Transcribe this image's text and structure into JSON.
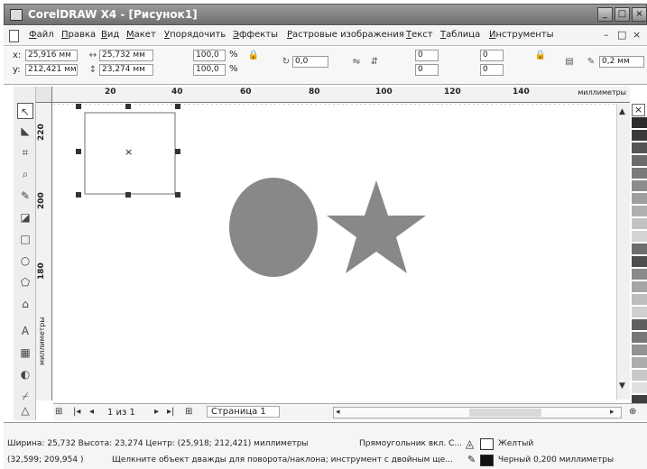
{
  "window": {
    "title": "CorelDRAW X4 - [Рисунок1]",
    "controls": [
      "_",
      "□",
      "×"
    ]
  },
  "menu": {
    "items": [
      "Файл",
      "Правка",
      "Вид",
      "Макет",
      "Упорядочить",
      "Эффекты",
      "Растровые изображения",
      "Текст",
      "Таблица",
      "Инструменты"
    ],
    "doc_controls": [
      "–",
      "□",
      "×"
    ]
  },
  "propbar": {
    "x_label": "x:",
    "x_value": "25,916 мм",
    "y_label": "y:",
    "y_value": "212,421 мм",
    "width_value": "25,732 мм",
    "height_value": "23,274 мм",
    "scale_x": "100,0",
    "scale_y": "100,0",
    "percent": "%",
    "rotation": "0,0",
    "corner_a": "0",
    "corner_b": "0",
    "corner_c": "0",
    "corner_d": "0",
    "outline_width": "0,2 мм"
  },
  "ruler": {
    "h_ticks": [
      "20",
      "40",
      "60",
      "80",
      "100",
      "120",
      "140"
    ],
    "h_unit": "миллиметры",
    "v_ticks": [
      "220",
      "200",
      "180"
    ],
    "v_unit": "миллиметры"
  },
  "canvas": {
    "circle_color": "#888888",
    "star_color": "#888888",
    "selection_marker": "×"
  },
  "pagebar": {
    "page_count": "1 из 1",
    "page_tab": "Страница 1"
  },
  "status": {
    "size_info": "Ширина: 25,732 Высота: 23,274 Центр: (25,918; 212,421) миллиметры",
    "object_info": "Прямоугольник вкл. С...",
    "fill_name": "Желтый",
    "cursor_pos": "(32,599; 209,954 )",
    "hint": "Щелкните объект дважды для поворота/наклона; инструмент с двойным ще...",
    "outline_info": "Черный 0,200 миллиметры"
  },
  "palette_colors": [
    "#2b2b2b",
    "#3a3a3a",
    "#555555",
    "#6b6b6b",
    "#7a7a7a",
    "#8c8c8c",
    "#9e9e9e",
    "#b0b0b0",
    "#c2c2c2",
    "#d4d4d4",
    "#6e6e6e",
    "#4e4e4e",
    "#8a8a8a",
    "#a6a6a6",
    "#bdbdbd",
    "#cfcfcf",
    "#5f5f5f",
    "#777777",
    "#939393",
    "#adadad",
    "#c8c8c8",
    "#e0e0e0",
    "#3f3f3f"
  ]
}
